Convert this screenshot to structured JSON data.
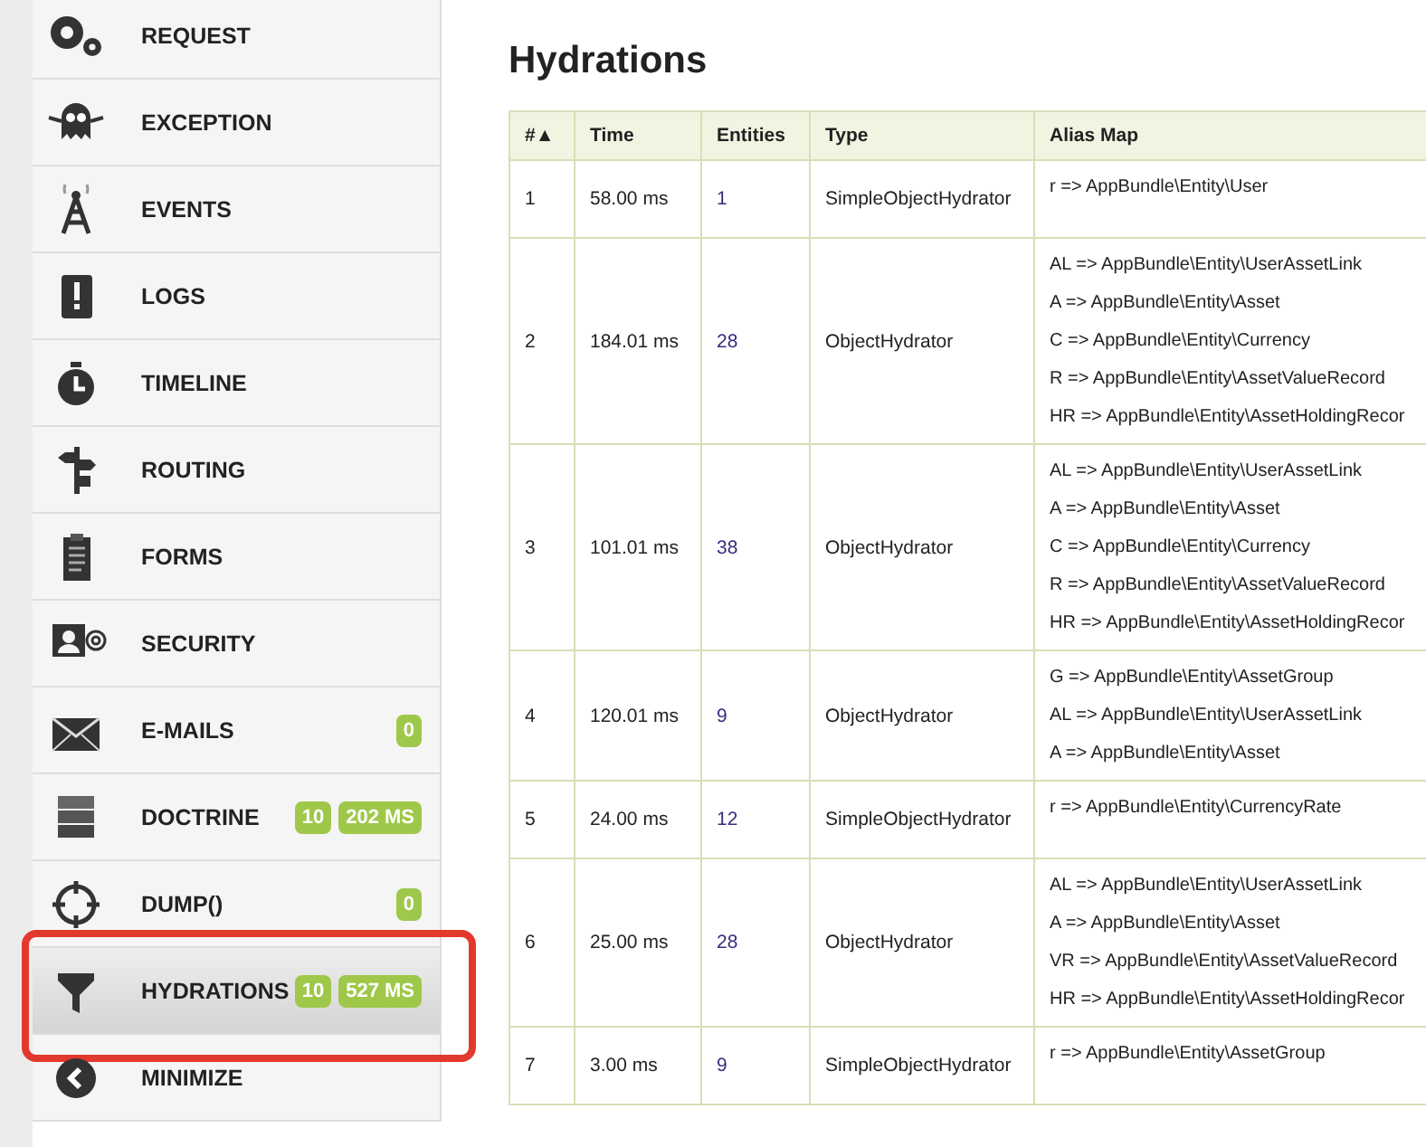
{
  "sidebar": {
    "items": [
      {
        "label": "REQUEST",
        "selected": false,
        "annotated": false
      },
      {
        "label": "EXCEPTION",
        "selected": false,
        "annotated": false
      },
      {
        "label": "EVENTS",
        "selected": false,
        "annotated": false
      },
      {
        "label": "LOGS",
        "selected": false,
        "annotated": false
      },
      {
        "label": "TIMELINE",
        "selected": false,
        "annotated": false
      },
      {
        "label": "ROUTING",
        "selected": false,
        "annotated": false
      },
      {
        "label": "FORMS",
        "selected": false,
        "annotated": false
      },
      {
        "label": "SECURITY",
        "selected": false,
        "annotated": false
      },
      {
        "label": "E-MAILS",
        "selected": false,
        "annotated": false,
        "badges": [
          "0"
        ]
      },
      {
        "label": "DOCTRINE",
        "selected": false,
        "annotated": false,
        "badges": [
          "10",
          "202 MS"
        ]
      },
      {
        "label": "DUMP()",
        "selected": false,
        "annotated": false,
        "badges": [
          "0"
        ]
      },
      {
        "label": "HYDRATIONS",
        "selected": true,
        "annotated": true,
        "badges": [
          "10",
          "527 MS"
        ]
      },
      {
        "label": "MINIMIZE",
        "selected": false,
        "annotated": false
      }
    ]
  },
  "title": "Hydrations",
  "table": {
    "columns": [
      "#▲",
      "Time",
      "Entities",
      "Type",
      "Alias Map"
    ],
    "rows": [
      {
        "number": "1",
        "time": "58.00 ms",
        "entities": "1",
        "type": "SimpleObjectHydrator",
        "aliases": [
          "r => AppBundle\\Entity\\User"
        ]
      },
      {
        "number": "2",
        "time": "184.01 ms",
        "entities": "28",
        "type": "ObjectHydrator",
        "aliases": [
          "AL => AppBundle\\Entity\\UserAssetLink",
          "A => AppBundle\\Entity\\Asset",
          "C => AppBundle\\Entity\\Currency",
          "R => AppBundle\\Entity\\AssetValueRecord",
          "HR => AppBundle\\Entity\\AssetHoldingRecor"
        ]
      },
      {
        "number": "3",
        "time": "101.01 ms",
        "entities": "38",
        "type": "ObjectHydrator",
        "aliases": [
          "AL => AppBundle\\Entity\\UserAssetLink",
          "A => AppBundle\\Entity\\Asset",
          "C => AppBundle\\Entity\\Currency",
          "R => AppBundle\\Entity\\AssetValueRecord",
          "HR => AppBundle\\Entity\\AssetHoldingRecor"
        ]
      },
      {
        "number": "4",
        "time": "120.01 ms",
        "entities": "9",
        "type": "ObjectHydrator",
        "aliases": [
          "G => AppBundle\\Entity\\AssetGroup",
          "AL => AppBundle\\Entity\\UserAssetLink",
          "A => AppBundle\\Entity\\Asset"
        ]
      },
      {
        "number": "5",
        "time": "24.00 ms",
        "entities": "12",
        "type": "SimpleObjectHydrator",
        "aliases": [
          "r => AppBundle\\Entity\\CurrencyRate"
        ]
      },
      {
        "number": "6",
        "time": "25.00 ms",
        "entities": "28",
        "type": "ObjectHydrator",
        "aliases": [
          "AL => AppBundle\\Entity\\UserAssetLink",
          "A => AppBundle\\Entity\\Asset",
          "VR => AppBundle\\Entity\\AssetValueRecord",
          "HR => AppBundle\\Entity\\AssetHoldingRecor"
        ]
      },
      {
        "number": "7",
        "time": "3.00 ms",
        "entities": "9",
        "type": "SimpleObjectHydrator",
        "aliases": [
          "r => AppBundle\\Entity\\AssetGroup"
        ]
      }
    ]
  }
}
